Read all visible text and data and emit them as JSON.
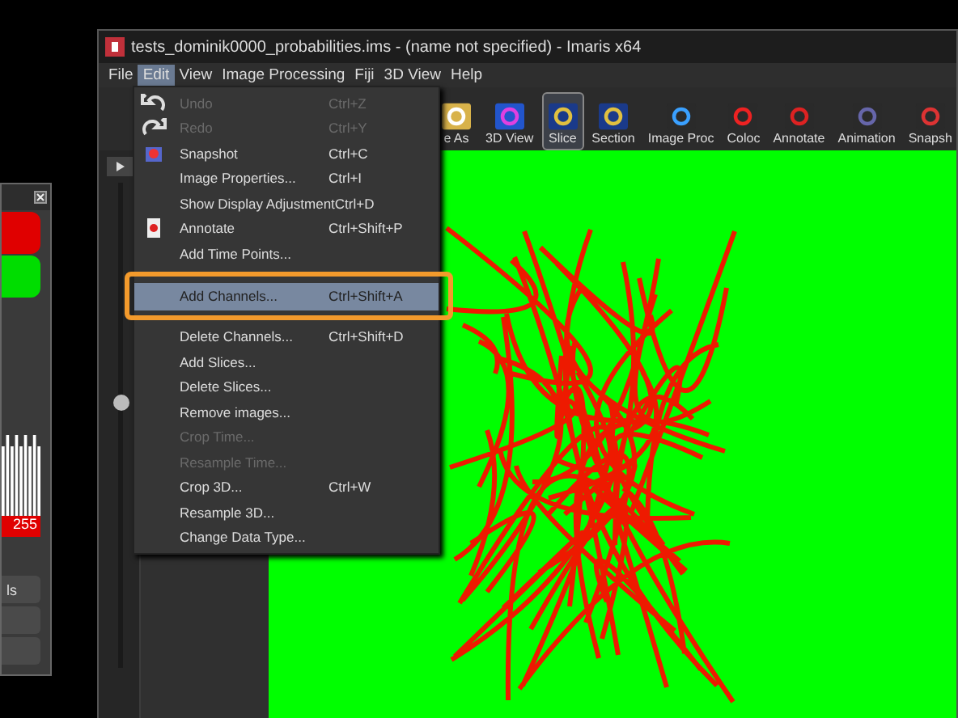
{
  "window": {
    "title": "tests_dominik0000_probabilities.ims - (name not specified) - Imaris x64"
  },
  "menu_bar": [
    {
      "label": "File",
      "selected": false
    },
    {
      "label": "Edit",
      "selected": true
    },
    {
      "label": "View",
      "selected": false
    },
    {
      "label": "Image Processing",
      "selected": false
    },
    {
      "label": "Fiji",
      "selected": false
    },
    {
      "label": "3D View",
      "selected": false
    },
    {
      "label": "Help",
      "selected": false
    }
  ],
  "toolbar": [
    {
      "label": "e As",
      "selected": false
    },
    {
      "label": "3D View",
      "selected": false
    },
    {
      "label": "Slice",
      "selected": true
    },
    {
      "label": "Section",
      "selected": false
    },
    {
      "label": "Image Proc",
      "selected": false
    },
    {
      "label": "Coloc",
      "selected": false
    },
    {
      "label": "Annotate",
      "selected": false
    },
    {
      "label": "Animation",
      "selected": false
    },
    {
      "label": "Snapsh",
      "selected": false
    }
  ],
  "edit_menu": [
    {
      "label": "Undo",
      "shortcut": "Ctrl+Z",
      "disabled": true,
      "selected": false
    },
    {
      "label": "Redo",
      "shortcut": "Ctrl+Y",
      "disabled": true,
      "selected": false
    },
    {
      "label": "Snapshot",
      "shortcut": "Ctrl+C",
      "disabled": false,
      "selected": false
    },
    {
      "label": "Image Properties...",
      "shortcut": "Ctrl+I",
      "disabled": false,
      "selected": false
    },
    {
      "label": "Show Display Adjustment",
      "shortcut": "Ctrl+D",
      "disabled": false,
      "selected": false
    },
    {
      "label": "Annotate",
      "shortcut": "Ctrl+Shift+P",
      "disabled": false,
      "selected": false
    },
    {
      "label": "Add Time Points...",
      "disabled": false,
      "selected": false
    },
    {
      "label": "Add Channels...",
      "shortcut": "Ctrl+Shift+A",
      "disabled": false,
      "selected": true
    },
    {
      "label": "Delete Channels...",
      "shortcut": "Ctrl+Shift+D",
      "disabled": false,
      "selected": false
    },
    {
      "label": "Add Slices...",
      "disabled": false,
      "selected": false
    },
    {
      "label": "Delete Slices...",
      "disabled": false,
      "selected": false
    },
    {
      "label": "Remove images...",
      "disabled": false,
      "selected": false
    },
    {
      "label": "Crop Time...",
      "disabled": true,
      "selected": false
    },
    {
      "label": "Resample Time...",
      "disabled": true,
      "selected": false
    },
    {
      "label": "Crop 3D...",
      "shortcut": "Ctrl+W",
      "disabled": false,
      "selected": false
    },
    {
      "label": "Resample 3D...",
      "disabled": false,
      "selected": false
    },
    {
      "label": "Change Data Type...",
      "disabled": false,
      "selected": false
    }
  ],
  "display_panel": {
    "max_value": "255",
    "button": "ls"
  }
}
